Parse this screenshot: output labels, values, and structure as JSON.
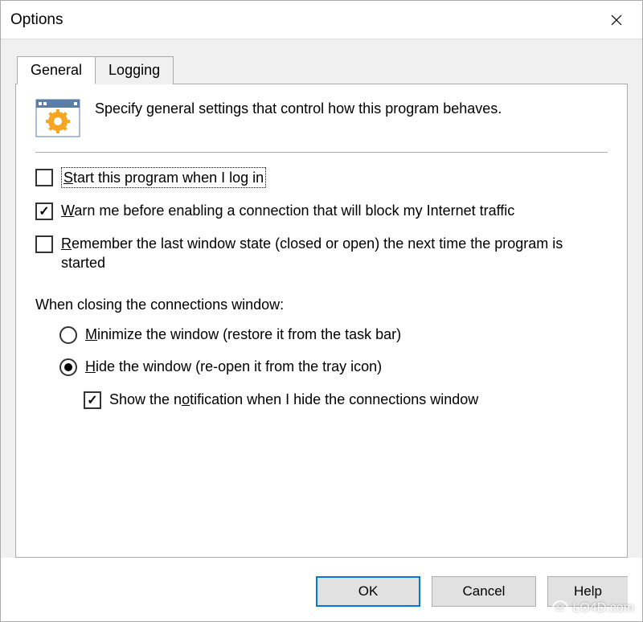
{
  "titlebar": {
    "title": "Options"
  },
  "tabs": {
    "general": "General",
    "logging": "Logging"
  },
  "intro": {
    "text": "Specify general settings that control how this program behaves."
  },
  "options": {
    "start_on_login": {
      "prefix": "S",
      "text": "tart this program when I log in",
      "checked": false
    },
    "warn_block": {
      "prefix": "W",
      "text": "arn me before enabling a connection that will block my Internet traffic",
      "checked": true
    },
    "remember_state": {
      "prefix": "R",
      "text": "emember the last window state (closed or open) the next time the program is started",
      "checked": false
    }
  },
  "close_section": {
    "heading": "When closing the connections window:",
    "minimize": {
      "prefix": "M",
      "text": "inimize the window (restore it from the task bar)",
      "checked": false
    },
    "hide": {
      "prefix": "H",
      "text": "ide the window (re-open it from the tray icon)",
      "checked": true
    },
    "show_notification": {
      "text_pre": "Show the n",
      "prefix": "o",
      "text_post": "tification when I hide the connections window",
      "checked": true
    }
  },
  "buttons": {
    "ok": "OK",
    "cancel": "Cancel",
    "help": "Help"
  },
  "watermark": "LO4D.com"
}
